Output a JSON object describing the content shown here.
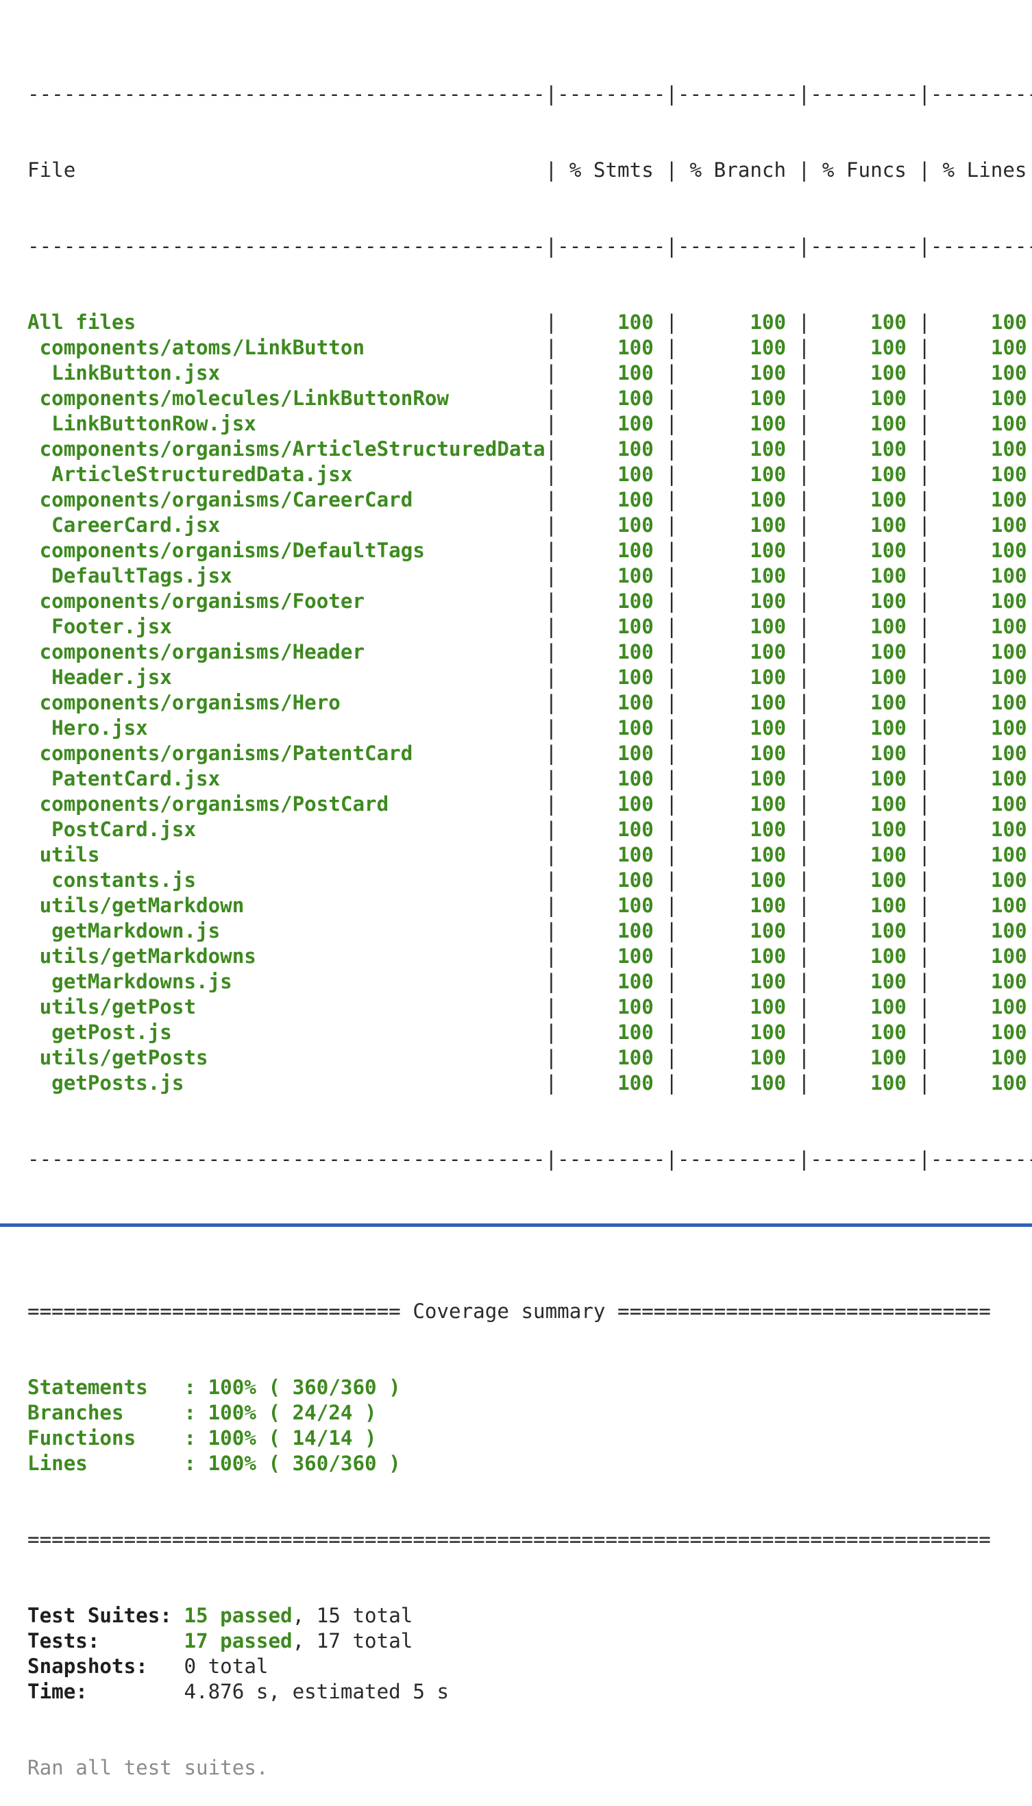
{
  "coverage_table": {
    "headers": {
      "file": "File",
      "stmts": "% Stmts",
      "branch": "% Branch",
      "funcs": "% Funcs",
      "lines": "% Lines"
    },
    "rows": [
      {
        "file": "All files",
        "stmts": "100",
        "branch": "100",
        "funcs": "100",
        "lines": "100",
        "indent": 0
      },
      {
        "file": "components/atoms/LinkButton",
        "stmts": "100",
        "branch": "100",
        "funcs": "100",
        "lines": "100",
        "indent": 1
      },
      {
        "file": "LinkButton.jsx",
        "stmts": "100",
        "branch": "100",
        "funcs": "100",
        "lines": "100",
        "indent": 2
      },
      {
        "file": "components/molecules/LinkButtonRow",
        "stmts": "100",
        "branch": "100",
        "funcs": "100",
        "lines": "100",
        "indent": 1
      },
      {
        "file": "LinkButtonRow.jsx",
        "stmts": "100",
        "branch": "100",
        "funcs": "100",
        "lines": "100",
        "indent": 2
      },
      {
        "file": "components/organisms/ArticleStructuredData",
        "stmts": "100",
        "branch": "100",
        "funcs": "100",
        "lines": "100",
        "indent": 1
      },
      {
        "file": "ArticleStructuredData.jsx",
        "stmts": "100",
        "branch": "100",
        "funcs": "100",
        "lines": "100",
        "indent": 2
      },
      {
        "file": "components/organisms/CareerCard",
        "stmts": "100",
        "branch": "100",
        "funcs": "100",
        "lines": "100",
        "indent": 1
      },
      {
        "file": "CareerCard.jsx",
        "stmts": "100",
        "branch": "100",
        "funcs": "100",
        "lines": "100",
        "indent": 2
      },
      {
        "file": "components/organisms/DefaultTags",
        "stmts": "100",
        "branch": "100",
        "funcs": "100",
        "lines": "100",
        "indent": 1
      },
      {
        "file": "DefaultTags.jsx",
        "stmts": "100",
        "branch": "100",
        "funcs": "100",
        "lines": "100",
        "indent": 2
      },
      {
        "file": "components/organisms/Footer",
        "stmts": "100",
        "branch": "100",
        "funcs": "100",
        "lines": "100",
        "indent": 1
      },
      {
        "file": "Footer.jsx",
        "stmts": "100",
        "branch": "100",
        "funcs": "100",
        "lines": "100",
        "indent": 2
      },
      {
        "file": "components/organisms/Header",
        "stmts": "100",
        "branch": "100",
        "funcs": "100",
        "lines": "100",
        "indent": 1
      },
      {
        "file": "Header.jsx",
        "stmts": "100",
        "branch": "100",
        "funcs": "100",
        "lines": "100",
        "indent": 2
      },
      {
        "file": "components/organisms/Hero",
        "stmts": "100",
        "branch": "100",
        "funcs": "100",
        "lines": "100",
        "indent": 1
      },
      {
        "file": "Hero.jsx",
        "stmts": "100",
        "branch": "100",
        "funcs": "100",
        "lines": "100",
        "indent": 2
      },
      {
        "file": "components/organisms/PatentCard",
        "stmts": "100",
        "branch": "100",
        "funcs": "100",
        "lines": "100",
        "indent": 1
      },
      {
        "file": "PatentCard.jsx",
        "stmts": "100",
        "branch": "100",
        "funcs": "100",
        "lines": "100",
        "indent": 2
      },
      {
        "file": "components/organisms/PostCard",
        "stmts": "100",
        "branch": "100",
        "funcs": "100",
        "lines": "100",
        "indent": 1
      },
      {
        "file": "PostCard.jsx",
        "stmts": "100",
        "branch": "100",
        "funcs": "100",
        "lines": "100",
        "indent": 2
      },
      {
        "file": "utils",
        "stmts": "100",
        "branch": "100",
        "funcs": "100",
        "lines": "100",
        "indent": 1
      },
      {
        "file": "constants.js",
        "stmts": "100",
        "branch": "100",
        "funcs": "100",
        "lines": "100",
        "indent": 2
      },
      {
        "file": "utils/getMarkdown",
        "stmts": "100",
        "branch": "100",
        "funcs": "100",
        "lines": "100",
        "indent": 1
      },
      {
        "file": "getMarkdown.js",
        "stmts": "100",
        "branch": "100",
        "funcs": "100",
        "lines": "100",
        "indent": 2
      },
      {
        "file": "utils/getMarkdowns",
        "stmts": "100",
        "branch": "100",
        "funcs": "100",
        "lines": "100",
        "indent": 1
      },
      {
        "file": "getMarkdowns.js",
        "stmts": "100",
        "branch": "100",
        "funcs": "100",
        "lines": "100",
        "indent": 2
      },
      {
        "file": "utils/getPost",
        "stmts": "100",
        "branch": "100",
        "funcs": "100",
        "lines": "100",
        "indent": 1
      },
      {
        "file": "getPost.js",
        "stmts": "100",
        "branch": "100",
        "funcs": "100",
        "lines": "100",
        "indent": 2
      },
      {
        "file": "utils/getPosts",
        "stmts": "100",
        "branch": "100",
        "funcs": "100",
        "lines": "100",
        "indent": 1
      },
      {
        "file": "getPosts.js",
        "stmts": "100",
        "branch": "100",
        "funcs": "100",
        "lines": "100",
        "indent": 2
      }
    ]
  },
  "coverage_summary": {
    "title": "Coverage summary",
    "items": [
      {
        "label": "Statements",
        "value": "100% ( 360/360 )"
      },
      {
        "label": "Branches",
        "value": "100% ( 24/24 )"
      },
      {
        "label": "Functions",
        "value": "100% ( 14/14 )"
      },
      {
        "label": "Lines",
        "value": "100% ( 360/360 )"
      }
    ]
  },
  "test_results": {
    "test_suites": {
      "label": "Test Suites:",
      "passed": "15 passed",
      "total": "15 total"
    },
    "tests": {
      "label": "Tests:",
      "passed": "17 passed",
      "total": "17 total"
    },
    "snapshots": {
      "label": "Snapshots:",
      "value": "0 total"
    },
    "time": {
      "label": "Time:",
      "value": "4.876 s, estimated 5 s"
    },
    "footer": "Ran all test suites."
  },
  "colors": {
    "pass_green": "#3d8a1f",
    "text": "#2a2a2a",
    "dim": "#8b8b8b",
    "accent_bar": "#2f63b8"
  }
}
